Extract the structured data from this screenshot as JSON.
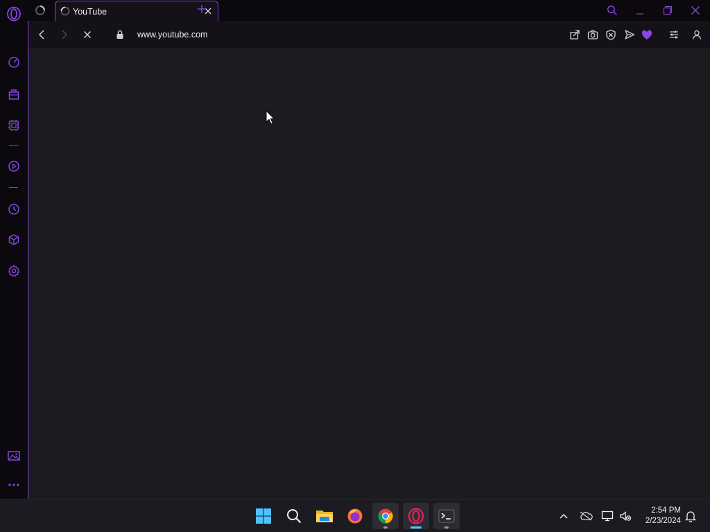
{
  "browser": {
    "name": "Opera GX",
    "accent": "#8a43e6"
  },
  "tabs": [
    {
      "title": "YouTube",
      "loading": true,
      "active": true
    }
  ],
  "addressbar": {
    "url": "www.youtube.com",
    "secure": true,
    "loading": true
  },
  "sidebar": {
    "items": [
      "speed-dial-icon",
      "shopping-bag-icon",
      "gx-control-icon",
      "player-icon",
      "history-icon",
      "extensions-icon",
      "settings-icon",
      "gallery-icon",
      "more-icon"
    ]
  },
  "toolbar": {
    "icons": [
      "share-icon",
      "snapshot-icon",
      "adblock-icon",
      "send-icon",
      "my-flow-icon",
      "easy-setup-icon",
      "profile-icon"
    ]
  },
  "taskbar": {
    "apps": [
      "Start",
      "Search",
      "File Explorer",
      "Firefox",
      "Google Chrome",
      "Opera GX",
      "Terminal"
    ],
    "clock": {
      "time": "2:54 PM",
      "date": "2/23/2024"
    }
  }
}
